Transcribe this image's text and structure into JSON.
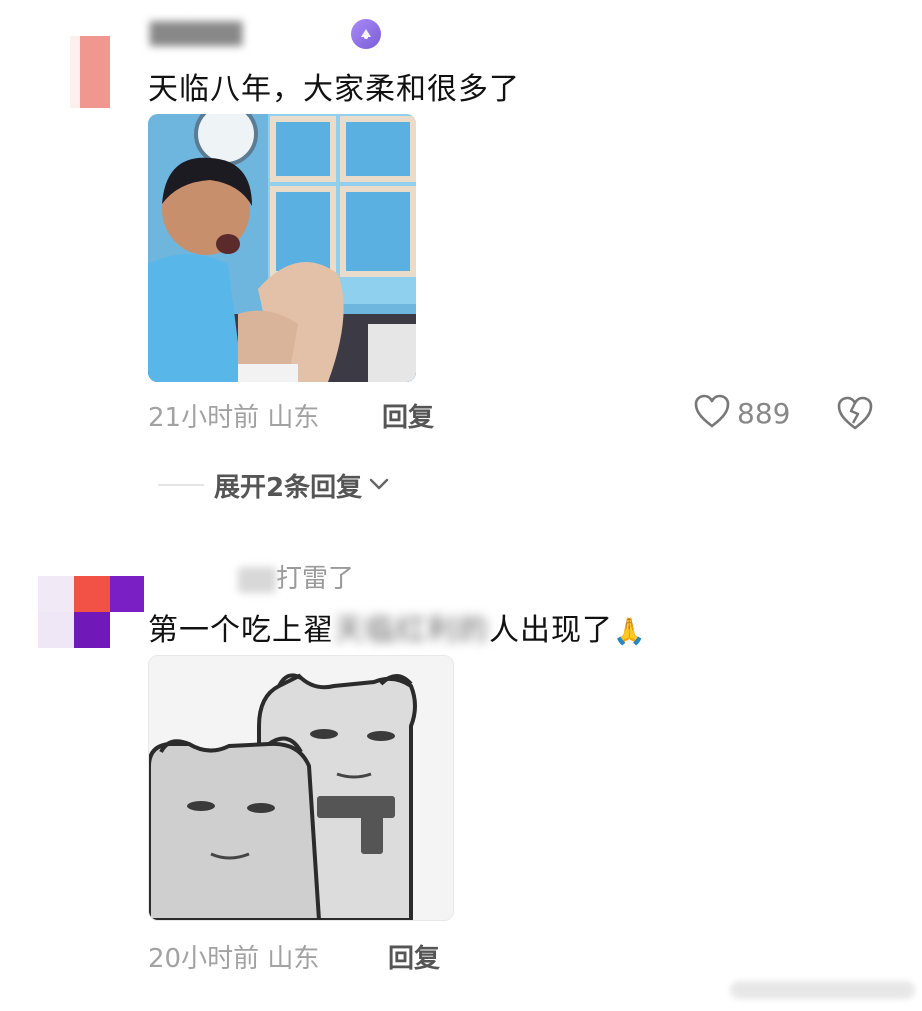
{
  "comments": [
    {
      "username": "▇▇▇▇▇",
      "text": "天临八年，大家柔和很多了",
      "time": "21小时前",
      "location": "山东",
      "reply_label": "回复",
      "likes": "889",
      "expand_label": "展开2条回复",
      "sticker": "crying-boy-sticker"
    },
    {
      "username": "打雷了",
      "text_visible_start": "第一个吃上翟",
      "text_blurred": "天临红利的",
      "text_visible_end": "人出现了",
      "emoji": "🙏",
      "time": "20小时前",
      "location": "山东",
      "reply_label": "回复",
      "sticker": "bear-cat-sticker"
    }
  ],
  "colors": {
    "text": "#111111",
    "meta": "#a2a2a2",
    "badge": "#8a6de6"
  }
}
